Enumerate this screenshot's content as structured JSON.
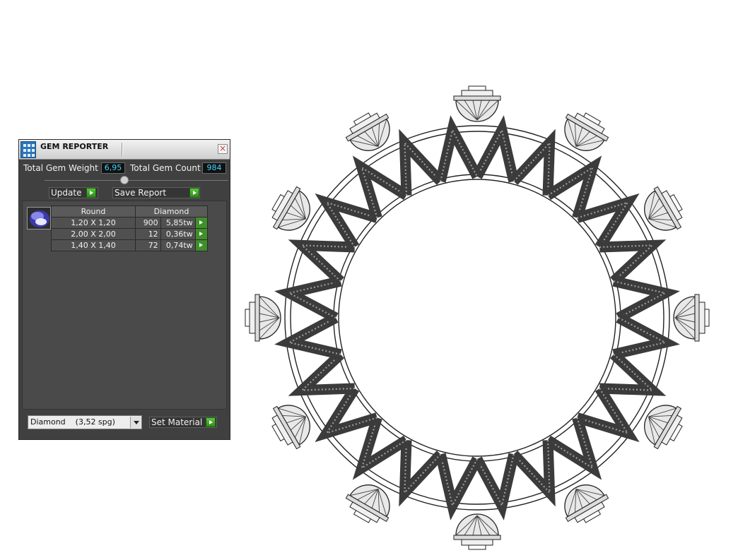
{
  "panel": {
    "title": "GEM REPORTER",
    "close_label": "×",
    "total_weight_label": "Total Gem Weight",
    "total_weight_value": "6,95",
    "total_count_label": "Total Gem Count",
    "total_count_value": "984",
    "update_label": "Update",
    "save_report_label": "Save Report",
    "table": {
      "headers": [
        "Round",
        "Diamond"
      ],
      "rows": [
        {
          "size": "1,20 X 1,20",
          "count": "900",
          "weight": "5,85tw"
        },
        {
          "size": "2,00 X 2,00",
          "count": "12",
          "weight": "0,36tw"
        },
        {
          "size": "1,40 X 1,40",
          "count": "72",
          "weight": "0,74tw"
        }
      ]
    },
    "material_select": "Diamond    (3,52 spg)",
    "set_material_label": "Set Material"
  },
  "colors": {
    "panel_bg": "#404040",
    "value_text": "#40d8ff",
    "action_green": "#3f8f2a"
  },
  "icons": [
    "gem-reporter-app-icon",
    "close-icon",
    "play-arrow-icon",
    "round-gem-icon",
    "chevron-down-icon"
  ]
}
